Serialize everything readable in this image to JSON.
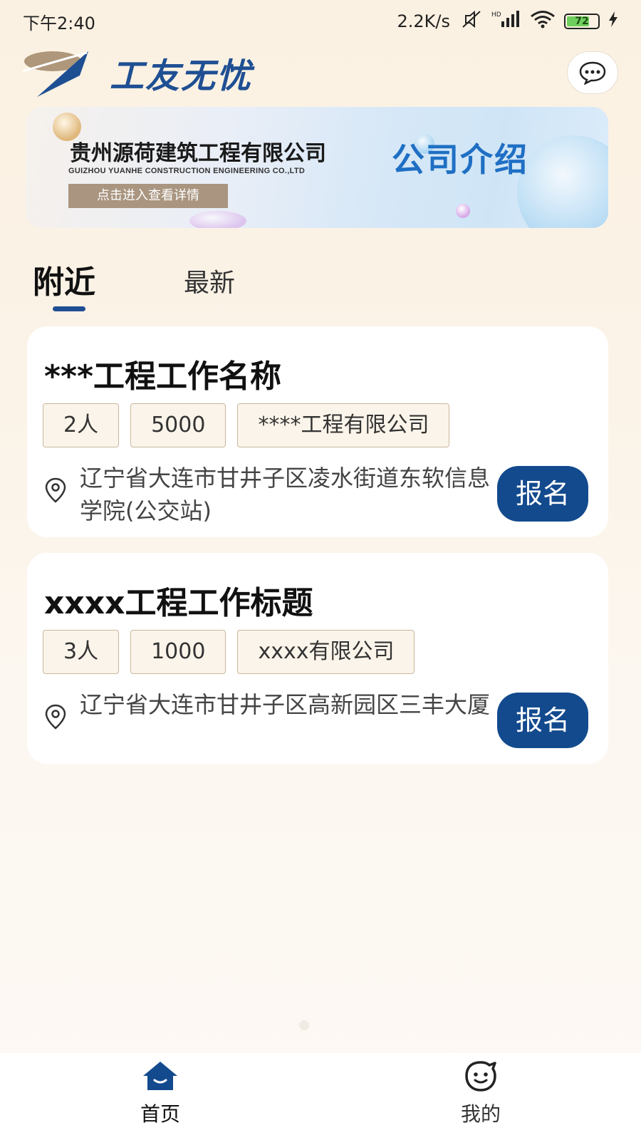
{
  "status_bar": {
    "time": "下午2:40",
    "net_speed": "2.2K/s",
    "battery_level": "72",
    "battery_fraction": 0.72
  },
  "header": {
    "app_name": "工友无忧",
    "chat_icon": "chat-bubble-icon"
  },
  "banner": {
    "company": "贵州源荷建筑工程有限公司",
    "company_en": "GUIZHOU YUANHE CONSTRUCTION ENGINEERING CO.,LTD",
    "button_label": "点击进入查看详情",
    "title": "公司介绍"
  },
  "tabs": [
    {
      "label": "附近",
      "active": true
    },
    {
      "label": "最新",
      "active": false
    }
  ],
  "jobs": [
    {
      "title": "***工程工作名称",
      "tags": [
        "2人",
        "5000",
        "****工程有限公司"
      ],
      "address": "辽宁省大连市甘井子区凌水街道东软信息学院(公交站)",
      "apply_label": "报名"
    },
    {
      "title": "xxxx工程工作标题",
      "tags": [
        "3人",
        "1000",
        "xxxx有限公司"
      ],
      "address": "辽宁省大连市甘井子区高新园区三丰大厦",
      "apply_label": "报名"
    }
  ],
  "bottom_nav": [
    {
      "label": "首页",
      "icon": "home-icon",
      "active": true
    },
    {
      "label": "我的",
      "icon": "profile-icon",
      "active": false
    }
  ],
  "colors": {
    "brand": "#1f4f93",
    "apply_button": "#134a8e",
    "banner_title": "#1f6fc4",
    "tag_border": "#c9b79d"
  }
}
